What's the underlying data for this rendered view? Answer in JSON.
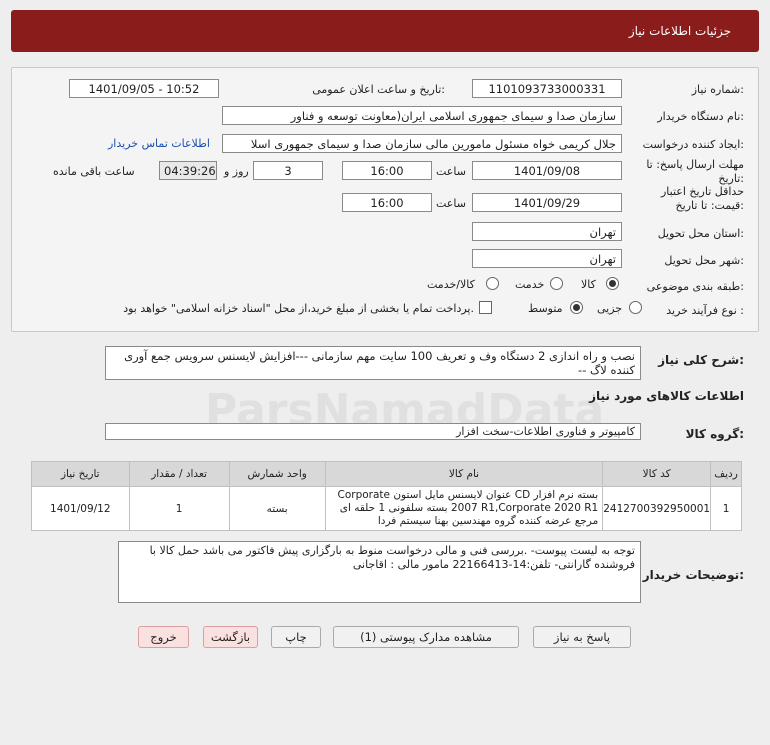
{
  "header": {
    "title": "جزئیات اطلاعات نیاز"
  },
  "form": {
    "need_number_label": "شماره نیاز:",
    "need_number": "1101093733000331",
    "announce_label": "تاریخ و ساعت اعلان عمومی:",
    "announce_value": "1401/09/05 - 10:52",
    "buyer_org_label": "نام دستگاه خریدار:",
    "buyer_org": "سازمان صدا و سیمای جمهوری اسلامی ایران(معاونت توسعه و فناور",
    "requester_label": "ایجاد کننده درخواست:",
    "requester": "جلال کریمی خواه مسئول مامورین مالی  سازمان صدا و سیمای جمهوری اسلا",
    "contact_link": "اطلاعات تماس خریدار",
    "reply_deadline_label": "مهلت ارسال پاسخ: تا تاریخ:",
    "reply_date": "1401/09/08",
    "time_label": "ساعت",
    "reply_time": "16:00",
    "days_value": "3",
    "days_label": "روز و",
    "remaining_time": "04:39:26",
    "remaining_label": "ساعت باقی مانده",
    "price_validity_label": "حداقل تاریخ اعتبار قیمت: تا تاریخ:",
    "price_date": "1401/09/29",
    "price_time": "16:00",
    "province_label": "استان محل تحویل:",
    "province": "تهران",
    "city_label": "شهر محل تحویل:",
    "city": "تهران",
    "category_label": "طبقه بندی موضوعی:",
    "category_options": [
      "کالا",
      "خدمت",
      "کالا/خدمت"
    ],
    "process_label": "نوع فرآیند خرید :",
    "process_options": [
      "جزیی",
      "متوسط"
    ],
    "payment_note": "پرداخت تمام یا بخشی از مبلغ خرید،از محل \"اسناد خزانه اسلامی\" خواهد بود."
  },
  "summary": {
    "label": "شرح کلی نیاز:",
    "text": "نصب و راه اندازی 2 دستگاه وف و تعریف 100 سایت مهم سازمانی ---افزایش لایسنس سرویس جمع آوری کننده لاگ --"
  },
  "goods_info_title": "اطلاعات کالاهای مورد نیاز",
  "goods_group_label": "گروه کالا:",
  "goods_group": "کامپیوتر و فناوری اطلاعات-سخت افزار",
  "table": {
    "headers": [
      "ردیف",
      "کد کالا",
      "نام کالا",
      "واحد شمارش",
      "تعداد / مقدار",
      "تاریخ نیاز"
    ],
    "rows": [
      {
        "row": "1",
        "code": "2412700392950001",
        "name": "بسته نرم افزار CD عنوان لایسنس مایل استون Corporate 2007 R1,Corporate 2020 R1 بسته سلفونی 1 حلقه ای مرجع عرضه کننده گروه مهندسین بهنا سیستم فردا",
        "unit": "بسته",
        "qty": "1",
        "date": "1401/09/12"
      }
    ]
  },
  "buyer_notes": {
    "label": "توضیحات خریدار:",
    "text": "توجه به لیست پیوست- .بررسی فنی و مالی درخواست منوط به بارگزاری پیش فاکتور می باشد  حمل کالا با فروشنده گارانتی- تلفن:14-22166413 مامور مالی : اقاجانی"
  },
  "buttons": {
    "reply": "پاسخ به نیاز",
    "attachments": "مشاهده مدارک پیوستی (1)",
    "print": "چاپ",
    "back": "بازگشت",
    "exit": "خروج"
  },
  "watermark": "ParsNamadData",
  "colors": {
    "header": "#8b1c1c",
    "link": "#1a4fb0"
  }
}
